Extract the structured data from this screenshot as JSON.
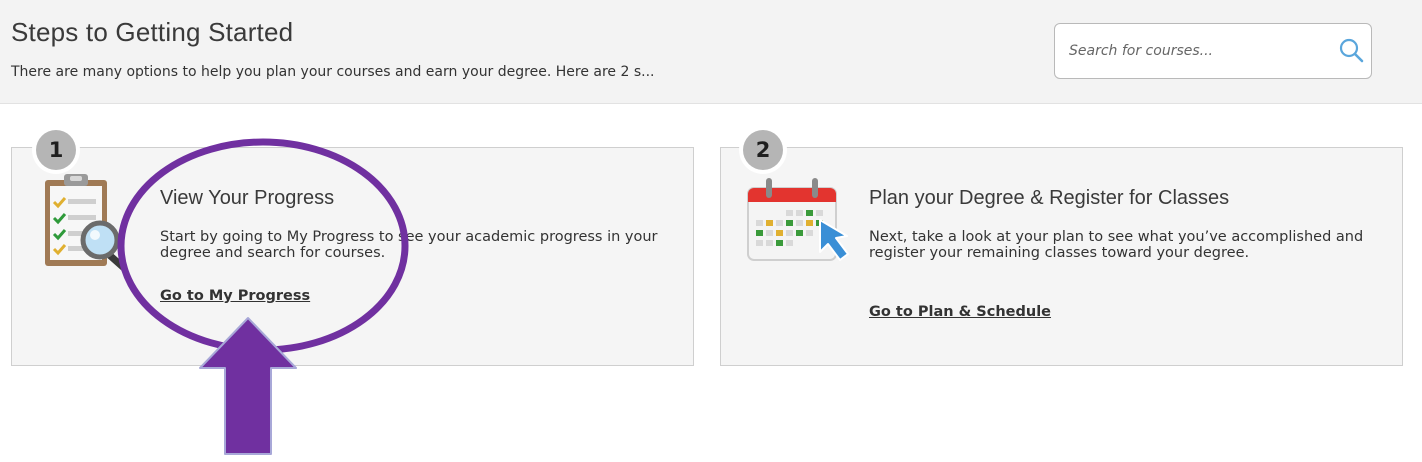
{
  "header": {
    "title": "Steps to Getting Started",
    "subtitle": "There are many options to help you plan your courses and earn your degree. Here are 2 s...",
    "search": {
      "placeholder": "Search for courses...",
      "icon": "search-icon"
    }
  },
  "steps": [
    {
      "number": "1",
      "title": "View Your Progress",
      "description": "Start by going to My Progress to see your academic progress in your degree and search for courses.",
      "link": "Go to My Progress",
      "icon": "clipboard-magnifier-icon"
    },
    {
      "number": "2",
      "title": "Plan your Degree & Register for Classes",
      "description": "Next, take a look at your plan to see what you’ve accomplished and register your remaining classes toward your degree.",
      "link": "Go to Plan & Schedule",
      "icon": "calendar-arrow-icon"
    }
  ],
  "annotation": {
    "color": "#7030a0",
    "shapes": [
      "highlight-ellipse",
      "pointer-arrow"
    ]
  },
  "colors": {
    "accent_blue": "#3a8fd6",
    "badge_gray": "#b5b5b5",
    "calendar_red": "#e3342f"
  }
}
